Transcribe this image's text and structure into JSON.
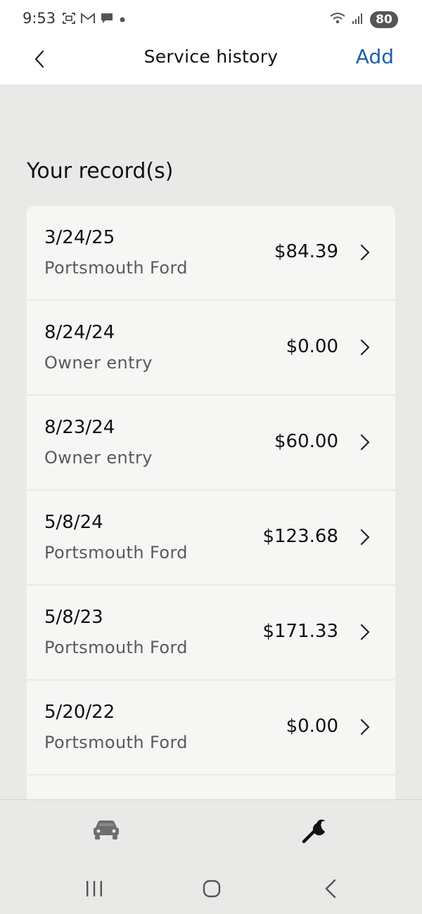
{
  "status_bar": {
    "time": "9:53",
    "battery": "80",
    "icons_left": [
      "screenshot-icon",
      "gmail-icon",
      "chat-bubble-icon",
      "dot-icon"
    ],
    "icons_right": [
      "wifi-icon",
      "signal-icon",
      "battery-icon"
    ]
  },
  "header": {
    "title": "Service history",
    "add_label": "Add",
    "back_icon": "chevron-left-icon"
  },
  "section": {
    "title": "Your record(s)"
  },
  "records": [
    {
      "date": "3/24/25",
      "source": "Portsmouth Ford",
      "amount": "$84.39"
    },
    {
      "date": "8/24/24",
      "source": "Owner entry",
      "amount": "$0.00"
    },
    {
      "date": "8/23/24",
      "source": "Owner entry",
      "amount": "$60.00"
    },
    {
      "date": "5/8/24",
      "source": "Portsmouth Ford",
      "amount": "$123.68"
    },
    {
      "date": "5/8/23",
      "source": "Portsmouth Ford",
      "amount": "$171.33"
    },
    {
      "date": "5/20/22",
      "source": "Portsmouth Ford",
      "amount": "$0.00"
    },
    {
      "date": "",
      "source": "",
      "amount": ""
    }
  ],
  "tabs": [
    {
      "name": "vehicle",
      "icon": "car-icon",
      "active": false
    },
    {
      "name": "service",
      "icon": "wrench-icon",
      "active": true
    }
  ],
  "colors": {
    "accent": "#1a5fb0",
    "background": "#e9e9e7",
    "card": "#f6f6f4",
    "inactive_icon": "#6e6e6e",
    "active_icon": "#111111"
  }
}
